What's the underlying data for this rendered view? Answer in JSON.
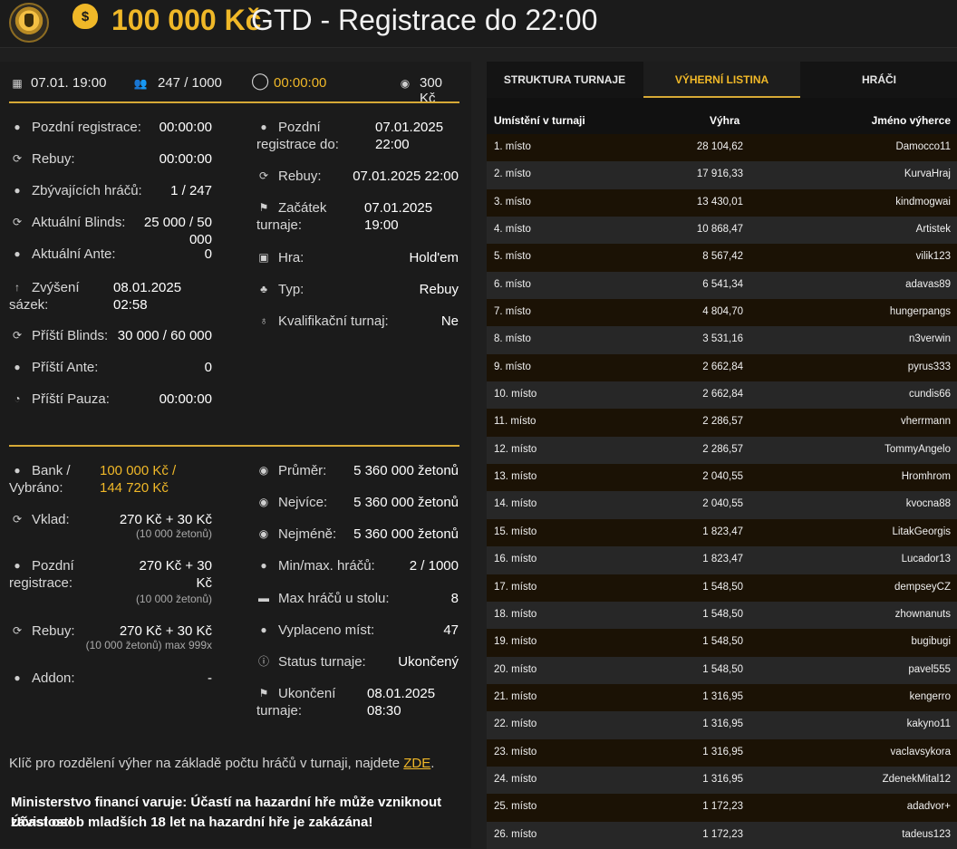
{
  "header": {
    "title_amount": "100 000 Kč",
    "title_rest": "GTD - Registrace do 22:00",
    "moneybag_symbol": "$"
  },
  "topbar": {
    "date": "07.01. 19:00",
    "players": "247 / 1000",
    "timer": "00:00:00",
    "buyin": "300 Kč"
  },
  "info_left": {
    "late_reg_label": "Pozdní registrace:",
    "late_reg_value": "00:00:00",
    "rebuy_label": "Rebuy:",
    "rebuy_value": "00:00:00",
    "remaining_label": "Zbývajících hráčů:",
    "remaining_value": "1 / 247",
    "blinds_label": "Aktuální Blinds:",
    "blinds_value": "25 000 / 50 000",
    "ante_label": "Aktuální Ante:",
    "ante_value": "0",
    "raise_label_1": "Zvýšení",
    "raise_label_2": "sázek:",
    "raise_value_1": "08.01.2025",
    "raise_value_2": "02:58",
    "next_blinds_label": "Příští Blinds:",
    "next_blinds_value": "30 000 / 60 000",
    "next_ante_label": "Příští Ante:",
    "next_ante_value": "0",
    "next_break_label": "Příští Pauza:",
    "next_break_value": "00:00:00"
  },
  "info_right": {
    "late_reg_until_1": "Pozdní",
    "late_reg_until_2": "registrace do:",
    "late_reg_until_value_1": "07.01.2025",
    "late_reg_until_value_2": "22:00",
    "rebuy_label": "Rebuy:",
    "rebuy_value": "07.01.2025 22:00",
    "start_label_1": "Začátek",
    "start_label_2": "turnaje:",
    "start_value_1": "07.01.2025",
    "start_value_2": "19:00",
    "game_label": "Hra:",
    "game_value": "Hold'em",
    "type_label": "Typ:",
    "type_value": "Rebuy",
    "qual_label": "Kvalifikační turnaj:",
    "qual_value": "Ne"
  },
  "bank": {
    "bank_label_1": "Bank /",
    "bank_label_2": "Vybráno:",
    "bank_value_1": "100 000 Kč /",
    "bank_value_2": "144 720 Kč",
    "deposit_label": "Vklad:",
    "deposit_value": "270 Kč + 30 Kč",
    "deposit_sub": "(10 000 žetonů)",
    "late_reg_label_1": "Pozdní",
    "late_reg_label_2": "registrace:",
    "late_reg_value_1": "270 Kč + 30",
    "late_reg_value_2": "Kč",
    "late_reg_sub": "(10 000 žetonů)",
    "rebuy_label": "Rebuy:",
    "rebuy_value": "270 Kč + 30 Kč",
    "rebuy_sub": "(10 000 žetonů) max 999x",
    "addon_label": "Addon:",
    "addon_value": "-"
  },
  "stats": {
    "avg_label": "Průměr:",
    "avg_value": "5 360 000 žetonů",
    "most_label": "Nejvíce:",
    "most_value": "5 360 000 žetonů",
    "least_label": "Nejméně:",
    "least_value": "5 360 000 žetonů",
    "minmax_label": "Min/max. hráčů:",
    "minmax_value": "2 / 1000",
    "table_label": "Max hráčů u stolu:",
    "table_value": "8",
    "paid_label": "Vyplaceno míst:",
    "paid_value": "47",
    "status_label": "Status turnaje:",
    "status_value": "Ukončený",
    "end_label_1": "Ukončení",
    "end_label_2": "turnaje:",
    "end_value_1": "08.01.2025",
    "end_value_2": "08:30"
  },
  "footer": {
    "note": "Klíč pro rozdělení výher na základě počtu hráčů v turnaji, najdete",
    "link": "ZDE",
    "note_end": ".",
    "warning_1": "Ministerstvo financí varuje: Účastí na hazardní hře může vzniknout závislost!",
    "warning_2": "Účast osob mladších 18 let na hazardní hře je zakázána!"
  },
  "tabs": [
    {
      "label": "STRUKTURA TURNAJE"
    },
    {
      "label": "VÝHERNÍ LISTINA"
    },
    {
      "label": "HRÁČI"
    }
  ],
  "table": {
    "headers": [
      "Umístění v turnaji",
      "Výhra",
      "Jméno výherce"
    ],
    "rows": [
      [
        "1. místo",
        "28 104,62",
        "Damocco11"
      ],
      [
        "2. místo",
        "17 916,33",
        "KurvaHraj"
      ],
      [
        "3. místo",
        "13 430,01",
        "kindmogwai"
      ],
      [
        "4. místo",
        "10 868,47",
        "Artistek"
      ],
      [
        "5. místo",
        "8 567,42",
        "vilik123"
      ],
      [
        "6. místo",
        "6 541,34",
        "adavas89"
      ],
      [
        "7. místo",
        "4 804,70",
        "hungerpangs"
      ],
      [
        "8. místo",
        "3 531,16",
        "n3verwin"
      ],
      [
        "9. místo",
        "2 662,84",
        "pyrus333"
      ],
      [
        "10. místo",
        "2 662,84",
        "cundis66"
      ],
      [
        "11. místo",
        "2 286,57",
        "vherrmann"
      ],
      [
        "12. místo",
        "2 286,57",
        "TommyAngelo"
      ],
      [
        "13. místo",
        "2 040,55",
        "Hromhrom"
      ],
      [
        "14. místo",
        "2 040,55",
        "kvocna88"
      ],
      [
        "15. místo",
        "1 823,47",
        "LitakGeorgis"
      ],
      [
        "16. místo",
        "1 823,47",
        "Lucador13"
      ],
      [
        "17. místo",
        "1 548,50",
        "dempseyCZ"
      ],
      [
        "18. místo",
        "1 548,50",
        "zhownanuts"
      ],
      [
        "19. místo",
        "1 548,50",
        "bugibugi"
      ],
      [
        "20. místo",
        "1 548,50",
        "pavel555"
      ],
      [
        "21. místo",
        "1 316,95",
        "kengerro"
      ],
      [
        "22. místo",
        "1 316,95",
        "kakyno11"
      ],
      [
        "23. místo",
        "1 316,95",
        "vaclavsykora"
      ],
      [
        "24. místo",
        "1 316,95",
        "ZdenekMital12"
      ],
      [
        "25. místo",
        "1 172,23",
        "adadvor+"
      ],
      [
        "26. místo",
        "1 172,23",
        "tadeus123"
      ]
    ]
  }
}
